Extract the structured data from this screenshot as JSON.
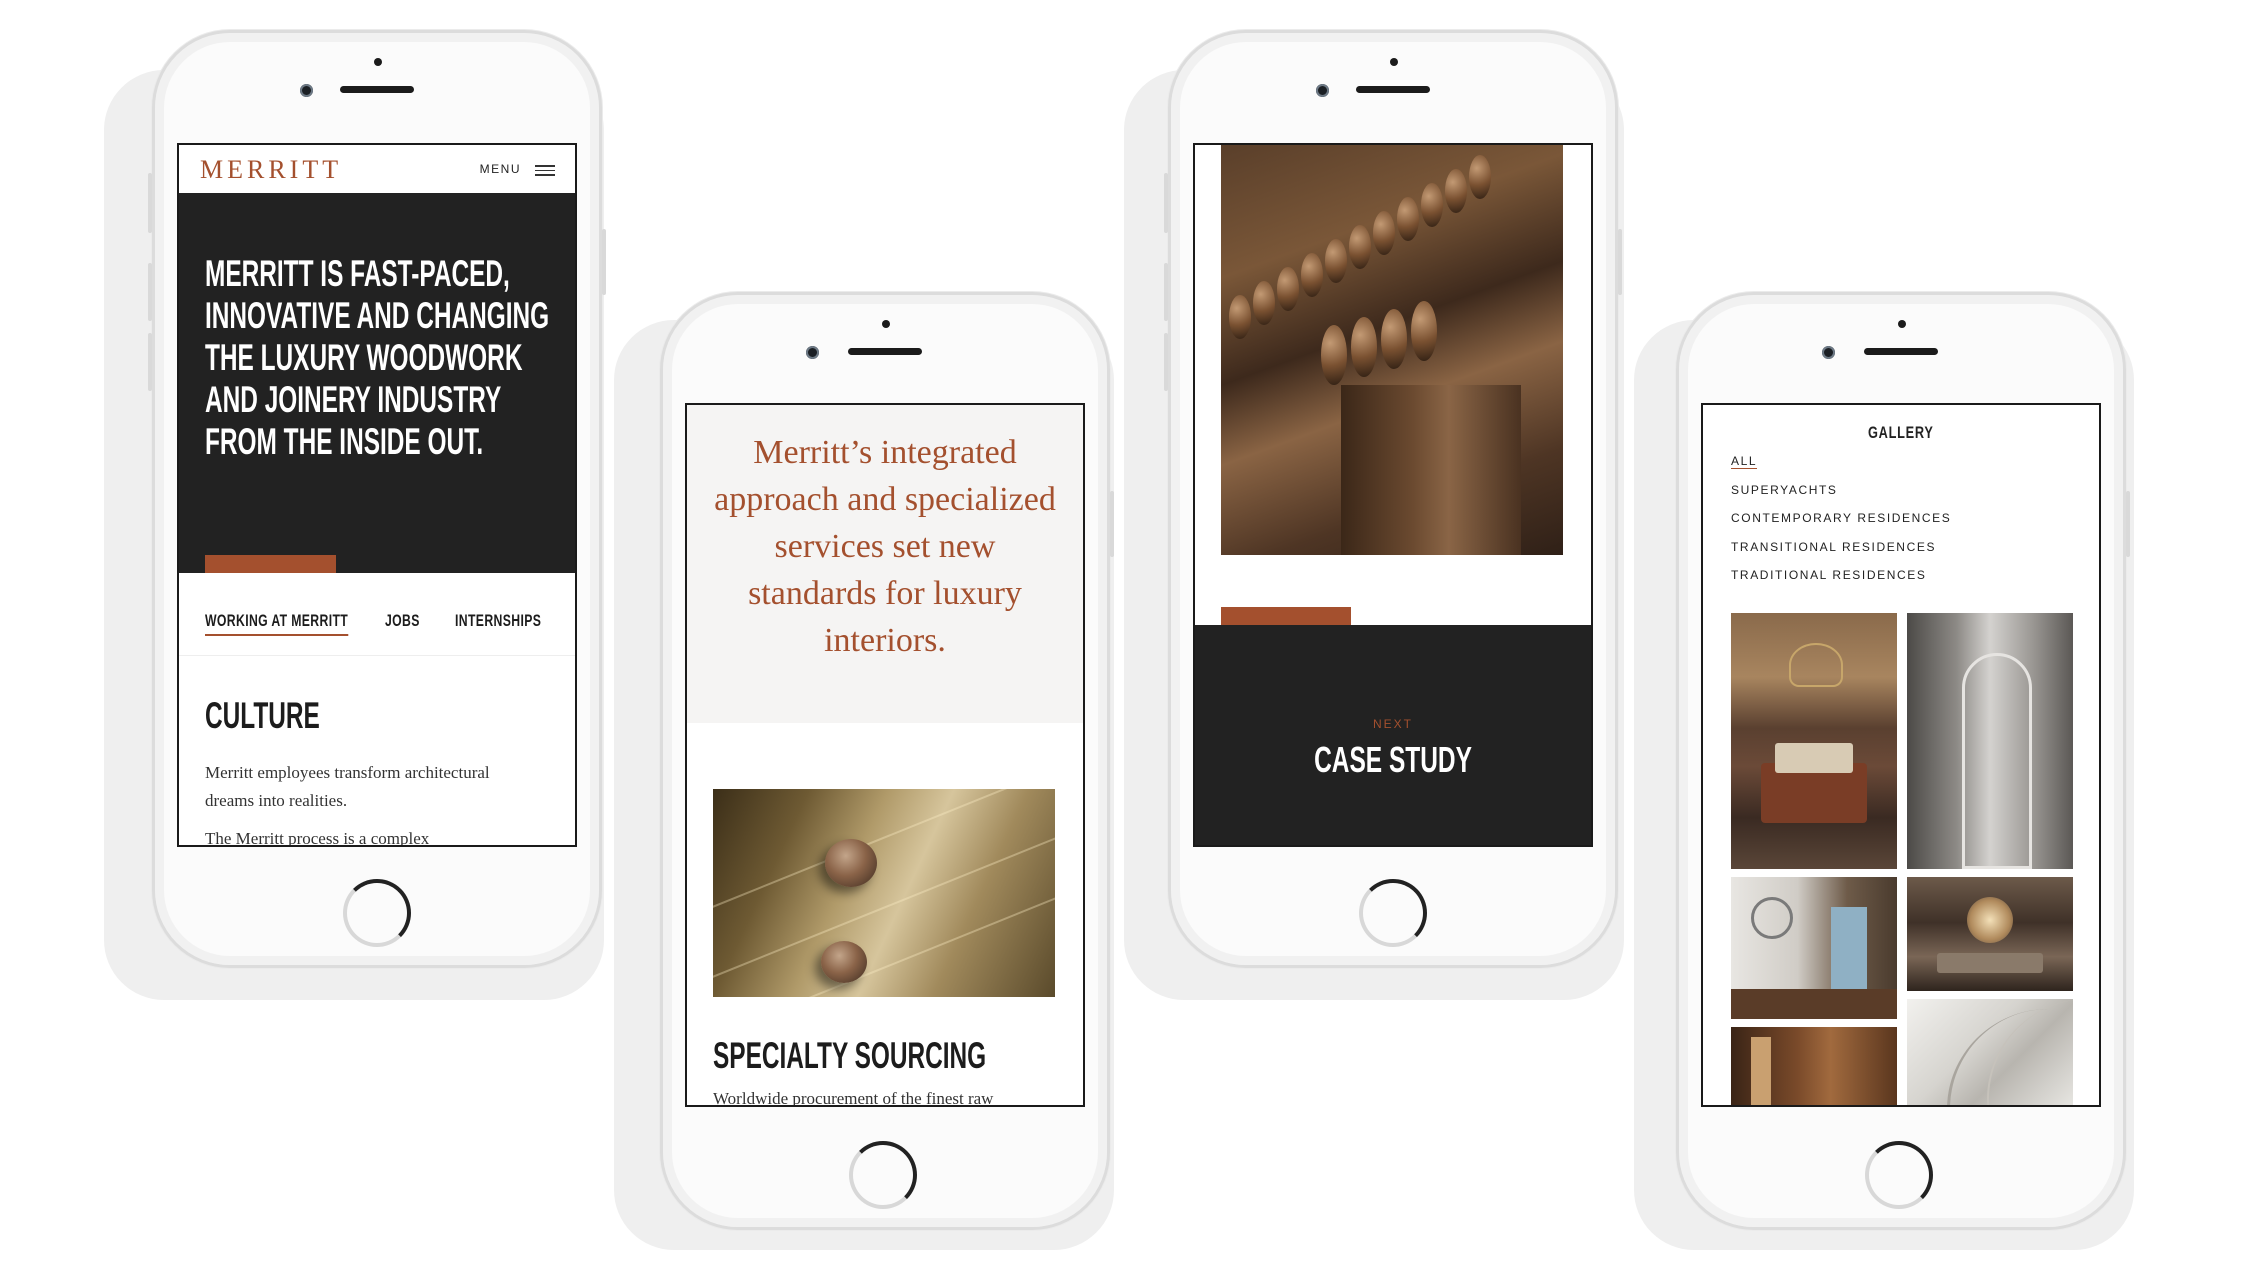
{
  "phone1": {
    "logo": "MERRITT",
    "menu_label": "MENU",
    "hero_lines": [
      "MERRITT IS FAST-PACED,",
      "INNOVATIVE AND CHANGING",
      "THE LUXURY WOODWORK",
      "AND JOINERY INDUSTRY",
      "FROM THE INSIDE OUT."
    ],
    "tabs": [
      "WORKING AT MERRITT",
      "JOBS",
      "INTERNSHIPS"
    ],
    "section_title": "CULTURE",
    "body_lines": [
      "Merritt employees transform architectural",
      "dreams into realities.",
      "The Merritt process is a complex"
    ]
  },
  "phone2": {
    "quote_lines": [
      "Merritt’s integrated",
      "approach and specialized",
      "services set new",
      "standards for luxury",
      "interiors."
    ],
    "section_title": "SPECIALTY SOURCING",
    "body": "Worldwide procurement of the finest raw"
  },
  "phone3": {
    "next_label": "NEXT",
    "case_label": "CASE STUDY"
  },
  "phone4": {
    "title": "GALLERY",
    "filters": [
      "ALL",
      "SUPERYACHTS",
      "CONTEMPORARY RESIDENCES",
      "TRANSITIONAL RESIDENCES",
      "TRADITIONAL RESIDENCES"
    ]
  },
  "colors": {
    "accent": "#a4502e",
    "dark": "#222222",
    "quote_bg": "#f5f4f3"
  }
}
